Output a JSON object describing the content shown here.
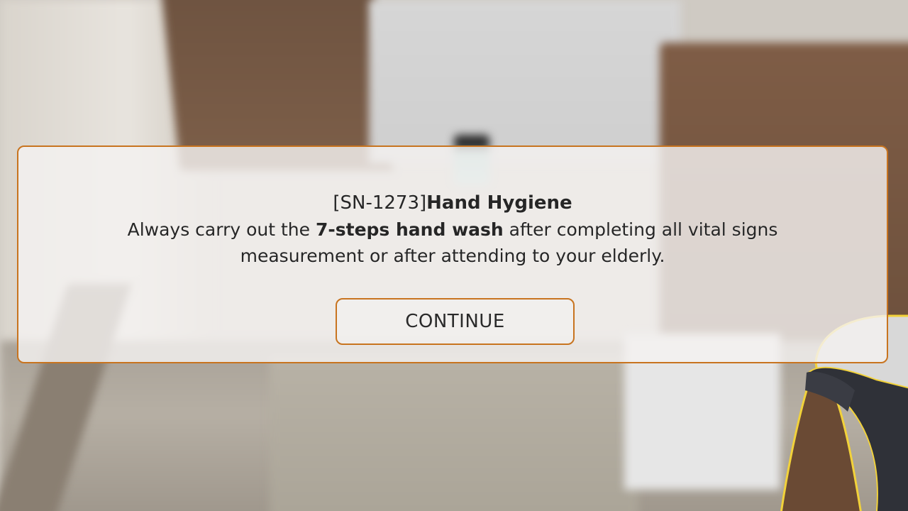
{
  "dialog": {
    "code": "[SN-1273]",
    "title": "Hand Hygiene",
    "body_before": "Always carry out the ",
    "body_bold": "7-steps hand wash",
    "body_after": " after completing all vital signs measurement or after attending to your elderly.",
    "continue_label": "CONTINUE"
  },
  "colors": {
    "accent": "#c8741f",
    "panel_bg": "#f4f2f0",
    "text": "#262626"
  }
}
